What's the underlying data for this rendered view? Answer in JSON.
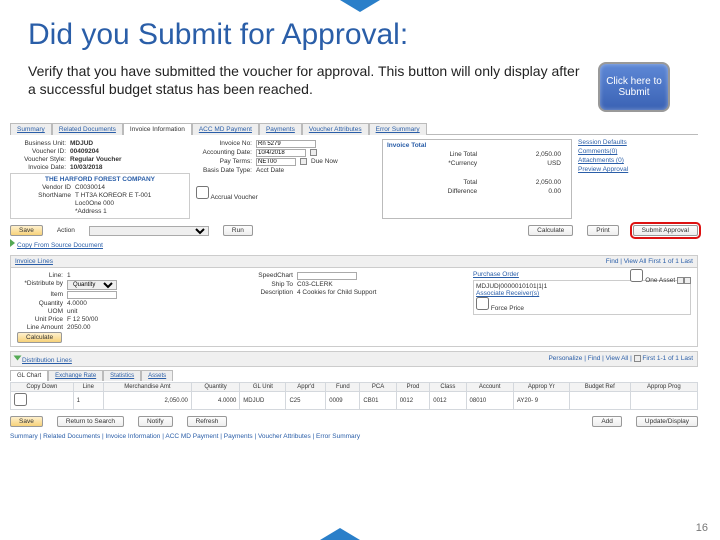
{
  "slide": {
    "title": "Did you Submit for Approval:",
    "subtitle": "Verify that you have submitted the voucher for approval.  This button will only display after a successful budget status has been reached.",
    "click_btn": "Click here to Submit",
    "page_num": "16"
  },
  "tabs": [
    "Summary",
    "Related Documents",
    "Invoice Information",
    "ACC MD Payment",
    "Payments",
    "Voucher Attributes",
    "Error Summary"
  ],
  "header": {
    "business_unit": "MDJUD",
    "voucher_id": "00409204",
    "voucher_style": "Regular Voucher",
    "invoice_date": "10/03/2018",
    "invoice_no": "Rn 5279",
    "accounting_date": "10/4/2018",
    "pay_terms": "NET00",
    "basis_date_type": "Acct Date",
    "due_now": "Due Now",
    "accrual": "Accrual Voucher"
  },
  "invoice_total": {
    "title": "Invoice Total",
    "line_total": "2,050.00",
    "currency": "USD",
    "total": "2,050.00",
    "difference": "0.00"
  },
  "session": {
    "title": "Session Defaults",
    "comments": "Comments(0)",
    "attachments": "Attachments (0)",
    "preview": "Preview Approval"
  },
  "vendor": {
    "name": "THE HARFORD FOREST COMPANY",
    "id": "C0030014",
    "shortname": "T HT3A KOREOR E T-001",
    "location": "Loc0One 000",
    "address": "*Address 1"
  },
  "actions": {
    "save": "Save",
    "action_label": "Action",
    "run": "Run",
    "calculate": "Calculate",
    "print": "Print",
    "submit": "Submit Approval",
    "copy": "Copy From Source Document"
  },
  "invoice_lines": {
    "title": "Invoice Lines",
    "hint": "Find | View All   First  1 of 1  Last",
    "left": {
      "line": "1",
      "dist_by": "Quantity",
      "item": "",
      "qty": "4.0000",
      "uom": "unit",
      "unit_price": "F 12 50/00",
      "line_amount": "2050.00",
      "calc_btn": "Calculate"
    },
    "mid": {
      "speedchart": "",
      "shipto": "C03-CLERK",
      "description": "4 Cookies for Child Support"
    },
    "right": {
      "po_title": "Purchase Order",
      "po": "MDJUD|0000010101|1|1",
      "assoc": "Associate Receiver(s)",
      "force": "Force Price",
      "one_asset": "One Asset"
    }
  },
  "gl": {
    "title": "Distribution Lines",
    "hint": "Personalize | Find | View All | ",
    "page": "First  1-1 of 1  Last",
    "subtabs": [
      "GL Chart",
      "Exchange Rate",
      "Statistics",
      "Assets"
    ],
    "cols": [
      "Copy Down",
      "Line",
      "Merchandise Amt",
      "Quantity",
      "GL Unit",
      "Appr'd",
      "Fund",
      "PCA",
      "Prod",
      "Class",
      "Account",
      "Approp Yr",
      "Budget Ref",
      "Approp Prog"
    ],
    "row": [
      "",
      "1",
      "2,050.00",
      "4.0000",
      "MDJUD",
      "C25",
      "0009",
      "CB01",
      "0012",
      "0012",
      "08010",
      "AY20- 9",
      "",
      ""
    ]
  },
  "footer": {
    "save": "Save",
    "notify": "Notify",
    "refresh": "Refresh",
    "return": "Return to Search",
    "add": "Add",
    "update": "Update/Display",
    "links": "Summary | Related Documents | Invoice Information | ACC MD Payment | Payments | Voucher Attributes | Error Summary"
  }
}
